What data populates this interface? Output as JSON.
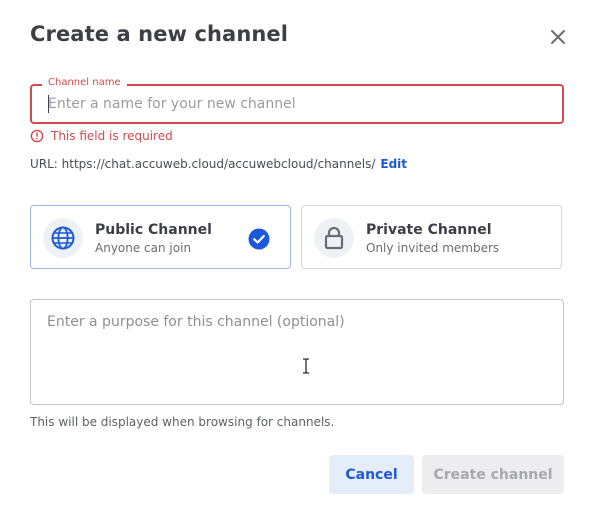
{
  "dialog": {
    "title": "Create a new channel"
  },
  "name_field": {
    "label": "Channel name",
    "placeholder": "Enter a name for your new channel",
    "value": "",
    "error": "This field is required"
  },
  "url": {
    "text": "URL: https://chat.accuweb.cloud/accuwebcloud/channels/",
    "edit_label": "Edit"
  },
  "channel_types": [
    {
      "title": "Public Channel",
      "subtitle": "Anyone can join",
      "icon": "globe-icon",
      "selected": true
    },
    {
      "title": "Private Channel",
      "subtitle": "Only invited members",
      "icon": "lock-icon",
      "selected": false
    }
  ],
  "purpose_field": {
    "placeholder": "Enter a purpose for this channel (optional)",
    "helper": "This will be displayed when browsing for channels."
  },
  "buttons": {
    "cancel": "Cancel",
    "create": "Create channel"
  },
  "colors": {
    "error": "#d24b4e",
    "accent": "#1c58d9",
    "text": "#3d3e46"
  }
}
